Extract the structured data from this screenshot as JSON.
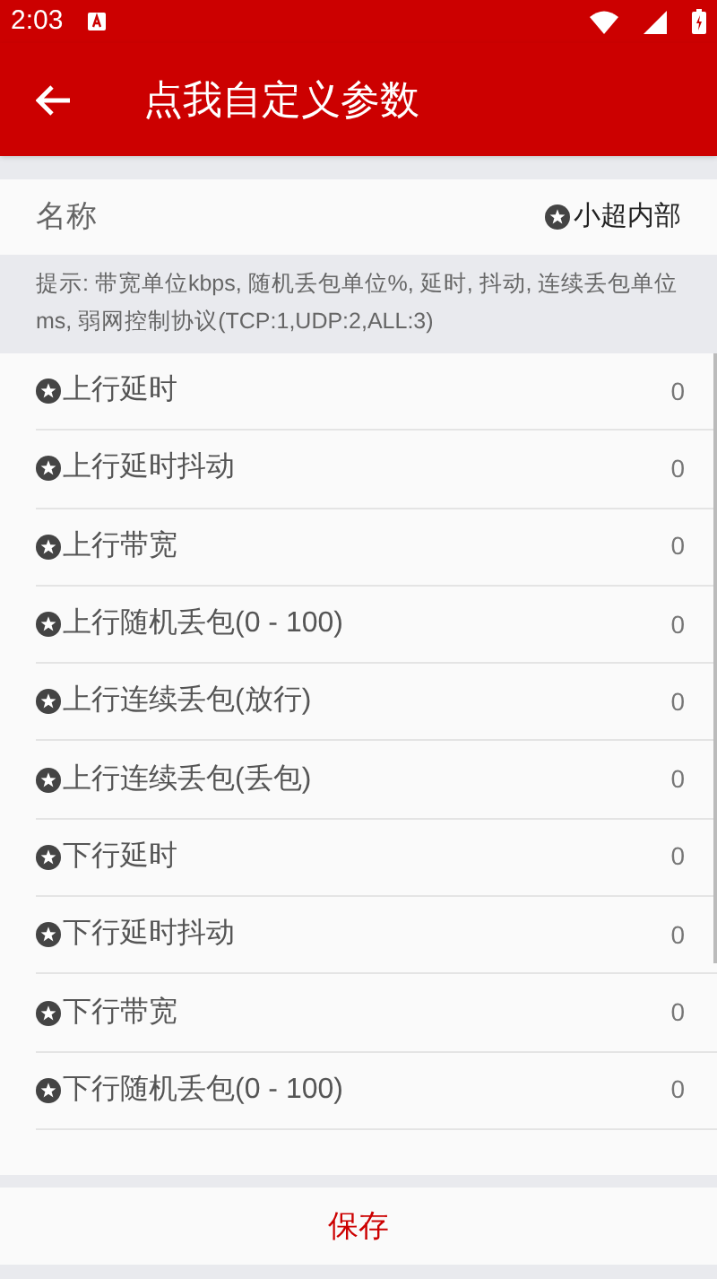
{
  "status_bar": {
    "time": "2:03"
  },
  "app_bar": {
    "title": "点我自定义参数"
  },
  "name_row": {
    "label": "名称",
    "value": "小超内部"
  },
  "hint": "提示: 带宽单位kbps, 随机丢包单位%, 延时, 抖动, 连续丢包单位ms, 弱网控制协议(TCP:1,UDP:2,ALL:3)",
  "params": [
    {
      "label": "上行延时",
      "value": "0"
    },
    {
      "label": "上行延时抖动",
      "value": "0"
    },
    {
      "label": "上行带宽",
      "value": "0"
    },
    {
      "label": "上行随机丢包(0 - 100)",
      "value": "0"
    },
    {
      "label": "上行连续丢包(放行)",
      "value": "0"
    },
    {
      "label": "上行连续丢包(丢包)",
      "value": "0"
    },
    {
      "label": "下行延时",
      "value": "0"
    },
    {
      "label": "下行延时抖动",
      "value": "0"
    },
    {
      "label": "下行带宽",
      "value": "0"
    },
    {
      "label": "下行随机丢包(0 - 100)",
      "value": "0"
    }
  ],
  "save_button": "保存"
}
